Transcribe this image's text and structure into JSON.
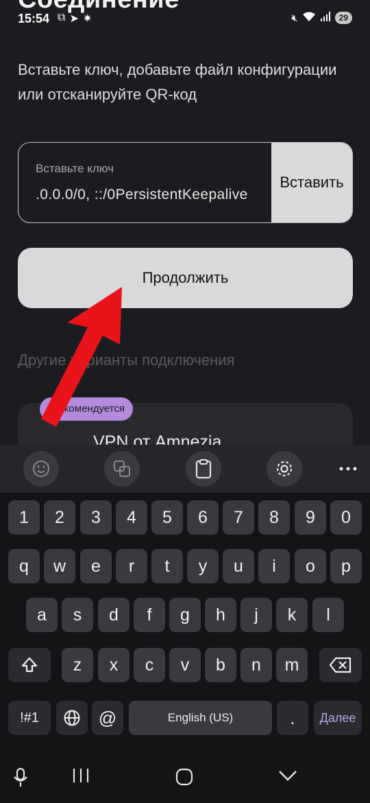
{
  "status_bar": {
    "time": "15:54",
    "battery": "29",
    "left_icons": [
      "screen-capture-icon",
      "telegram-icon",
      "sparkle-icon"
    ],
    "right_icons": [
      "mute-icon",
      "wifi-icon",
      "signal-icon"
    ]
  },
  "screen": {
    "title": "Соединение",
    "subtitle": "Вставьте ключ, добавьте файл конфигурации или отсканируйте QR-код",
    "key_field": {
      "label": "Вставьте ключ",
      "value": ".0.0.0/0, ::/0PersistentKeepalive"
    },
    "paste_button": "Вставить",
    "continue_button": "Продолжить",
    "other_options_label": "Другие варианты подключения",
    "recommended_badge": "Рекомендуется",
    "card_title": "VPN от Amnezia",
    "annotation_arrow_color": "#e8141a"
  },
  "keyboard": {
    "toolbar": [
      "emoji-icon",
      "translate-icon",
      "clipboard-icon",
      "settings-icon",
      "more-icon"
    ],
    "number_row": [
      "1",
      "2",
      "3",
      "4",
      "5",
      "6",
      "7",
      "8",
      "9",
      "0"
    ],
    "row1": [
      "q",
      "w",
      "e",
      "r",
      "t",
      "y",
      "u",
      "i",
      "o",
      "p"
    ],
    "row2": [
      "a",
      "s",
      "d",
      "f",
      "g",
      "h",
      "j",
      "k",
      "l"
    ],
    "row3": [
      "z",
      "x",
      "c",
      "v",
      "b",
      "n",
      "m"
    ],
    "symbols_key": "!#1",
    "at_key": "@",
    "space_label": "English (US)",
    "period_key": ".",
    "done_key": "Далее"
  },
  "nav_bar": [
    "microphone-icon",
    "recents-icon",
    "home-icon",
    "back-icon"
  ]
}
